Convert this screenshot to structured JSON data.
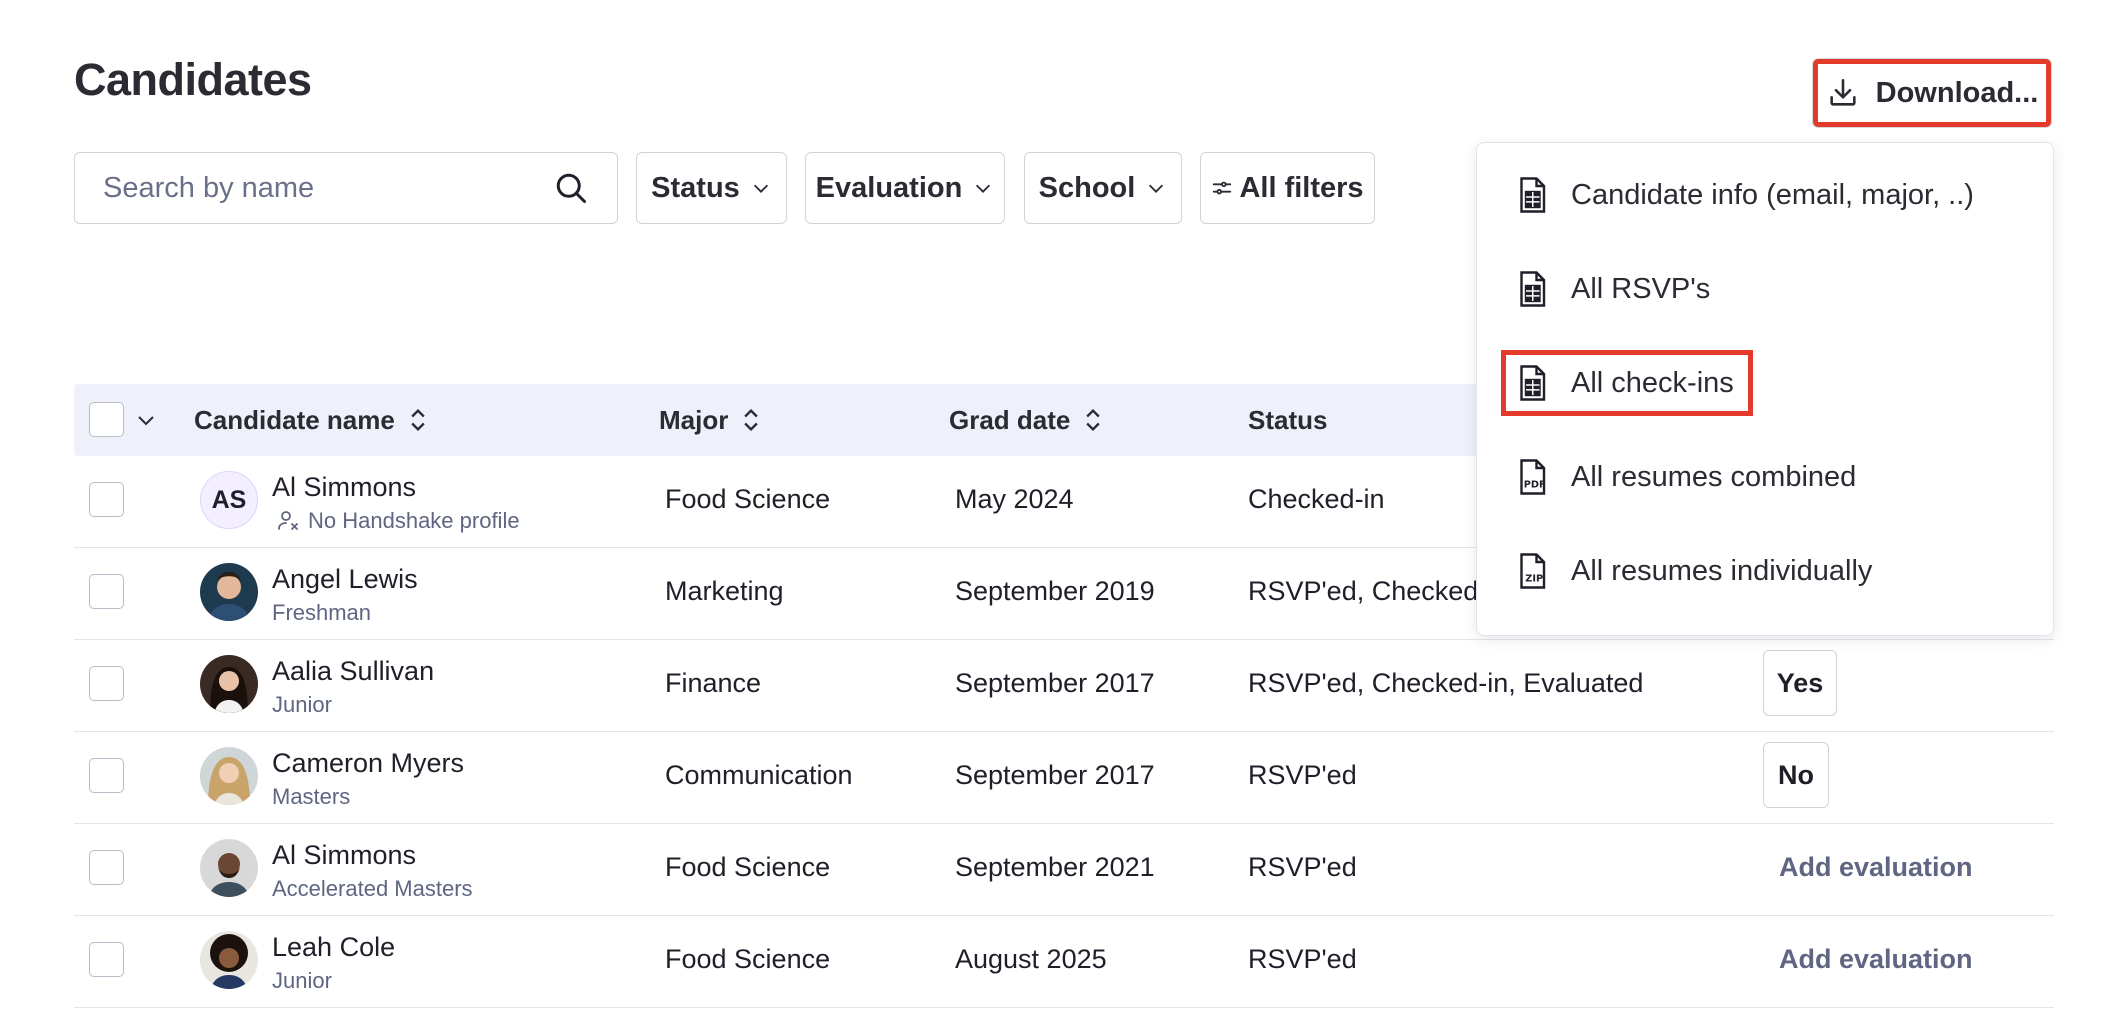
{
  "page": {
    "title": "Candidates"
  },
  "search": {
    "placeholder": "Search by name"
  },
  "filters": [
    {
      "label": "Status"
    },
    {
      "label": "Evaluation"
    },
    {
      "label": "School"
    },
    {
      "label": "All filters"
    }
  ],
  "download": {
    "label": "Download..."
  },
  "menu": {
    "items": [
      {
        "label": "Candidate info (email, major, ..)",
        "icon": "spreadsheet-file-icon"
      },
      {
        "label": "All RSVP's",
        "icon": "spreadsheet-file-icon"
      },
      {
        "label": "All check-ins",
        "icon": "spreadsheet-file-icon"
      },
      {
        "label": "All resumes combined",
        "icon": "pdf-file-icon"
      },
      {
        "label": "All resumes individually",
        "icon": "zip-file-icon"
      }
    ],
    "highlighted": "All check-ins"
  },
  "table": {
    "columns": [
      "Candidate name",
      "Major",
      "Grad date",
      "Status"
    ],
    "rows": [
      {
        "name": "Al Simmons",
        "initials": "AS",
        "sub": "No Handshake profile",
        "major": "Food Science",
        "grad": "May 2024",
        "status": "Checked-in",
        "evaluation": ""
      },
      {
        "name": "Angel Lewis",
        "sub": "Freshman",
        "major": "Marketing",
        "grad": "September 2019",
        "status": "RSVP'ed, Checked-i",
        "evaluation": ""
      },
      {
        "name": "Aalia Sullivan",
        "sub": "Junior",
        "major": "Finance",
        "grad": "September 2017",
        "status": "RSVP'ed, Checked-in, Evaluated",
        "evaluation": "Yes"
      },
      {
        "name": "Cameron Myers",
        "sub": "Masters",
        "major": "Communication",
        "grad": "September 2017",
        "status": "RSVP'ed",
        "evaluation": "No"
      },
      {
        "name": "Al Simmons",
        "sub": "Accelerated Masters",
        "major": "Food Science",
        "grad": "September 2021",
        "status": "RSVP'ed",
        "evaluation": "Add evaluation"
      },
      {
        "name": "Leah Cole",
        "sub": "Junior",
        "major": "Food Science",
        "grad": "August 2025",
        "status": "RSVP'ed",
        "evaluation": "Add evaluation"
      }
    ]
  },
  "colors": {
    "accent_red": "#e33a2c",
    "header_bg": "#eef1fa",
    "muted_text": "#5f6582"
  }
}
